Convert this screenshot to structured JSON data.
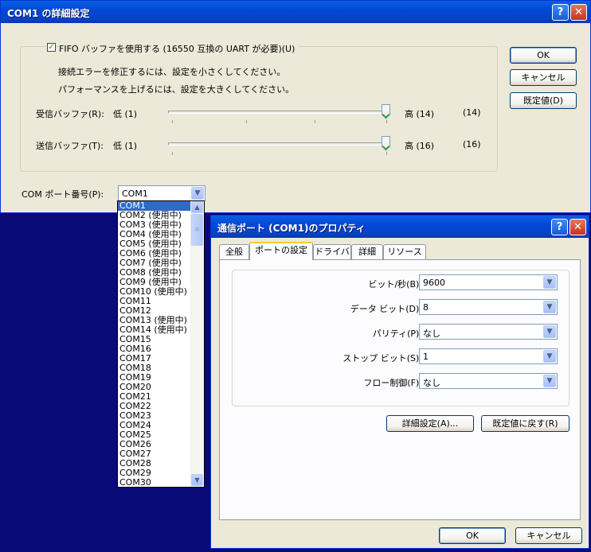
{
  "advanced_dialog": {
    "title": "COM1 の詳細設定",
    "help_glyph": "?",
    "close_glyph": "✕",
    "fifo_checkbox_label": "FIFO バッファを使用する (16550 互換の UART が必要)(U)",
    "fifo_checked": true,
    "hint_errors": "接続エラーを修正するには、設定を小さくしてください。",
    "hint_performance": "パフォーマンスを上げるには、設定を大きくしてください。",
    "receive_label": "受信バッファ(R):",
    "receive_low": "低 (1)",
    "receive_high": "高 (14)",
    "receive_value": "(14)",
    "transmit_label": "送信バッファ(T):",
    "transmit_low": "低 (1)",
    "transmit_high": "高 (16)",
    "transmit_value": "(16)",
    "receive_slider_level": 1.0,
    "transmit_slider_level": 1.0,
    "com_port_label": "COM ポート番号(P):",
    "com_port_value": "COM1",
    "ok_button": "OK",
    "cancel_button": "キャンセル",
    "defaults_button": "既定値(D)"
  },
  "com_port_dropdown": {
    "items": [
      "COM1",
      "COM2 (使用中)",
      "COM3 (使用中)",
      "COM4 (使用中)",
      "COM5 (使用中)",
      "COM6 (使用中)",
      "COM7 (使用中)",
      "COM8 (使用中)",
      "COM9 (使用中)",
      "COM10 (使用中)",
      "COM11",
      "COM12",
      "COM13 (使用中)",
      "COM14 (使用中)",
      "COM15",
      "COM16",
      "COM17",
      "COM18",
      "COM19",
      "COM20",
      "COM21",
      "COM22",
      "COM23",
      "COM24",
      "COM25",
      "COM26",
      "COM27",
      "COM28",
      "COM29",
      "COM30"
    ],
    "selected_index": 0
  },
  "properties_dialog": {
    "title": "通信ポート (COM1)のプロパティ",
    "help_glyph": "?",
    "close_glyph": "✕",
    "tabs": [
      "全般",
      "ポートの設定",
      "ドライバ",
      "詳細",
      "リソース"
    ],
    "active_tab": 1,
    "fields": [
      {
        "label": "ビット/秒(B):",
        "value": "9600"
      },
      {
        "label": "データ ビット(D):",
        "value": "8"
      },
      {
        "label": "パリティ(P):",
        "value": "なし"
      },
      {
        "label": "ストップ ビット(S):",
        "value": "1"
      },
      {
        "label": "フロー制御(F):",
        "value": "なし"
      }
    ],
    "advanced_button": "詳細設定(A)...",
    "restore_defaults_button": "既定値に戻す(R)",
    "ok_button": "OK",
    "cancel_button": "キャンセル"
  },
  "colors": {
    "desktop": "#0a0a78",
    "dialog_face": "#ece9d8",
    "titlebar": "#0149d7",
    "selection": "#316ac5",
    "active_tab_highlight": "#ffc83c"
  }
}
